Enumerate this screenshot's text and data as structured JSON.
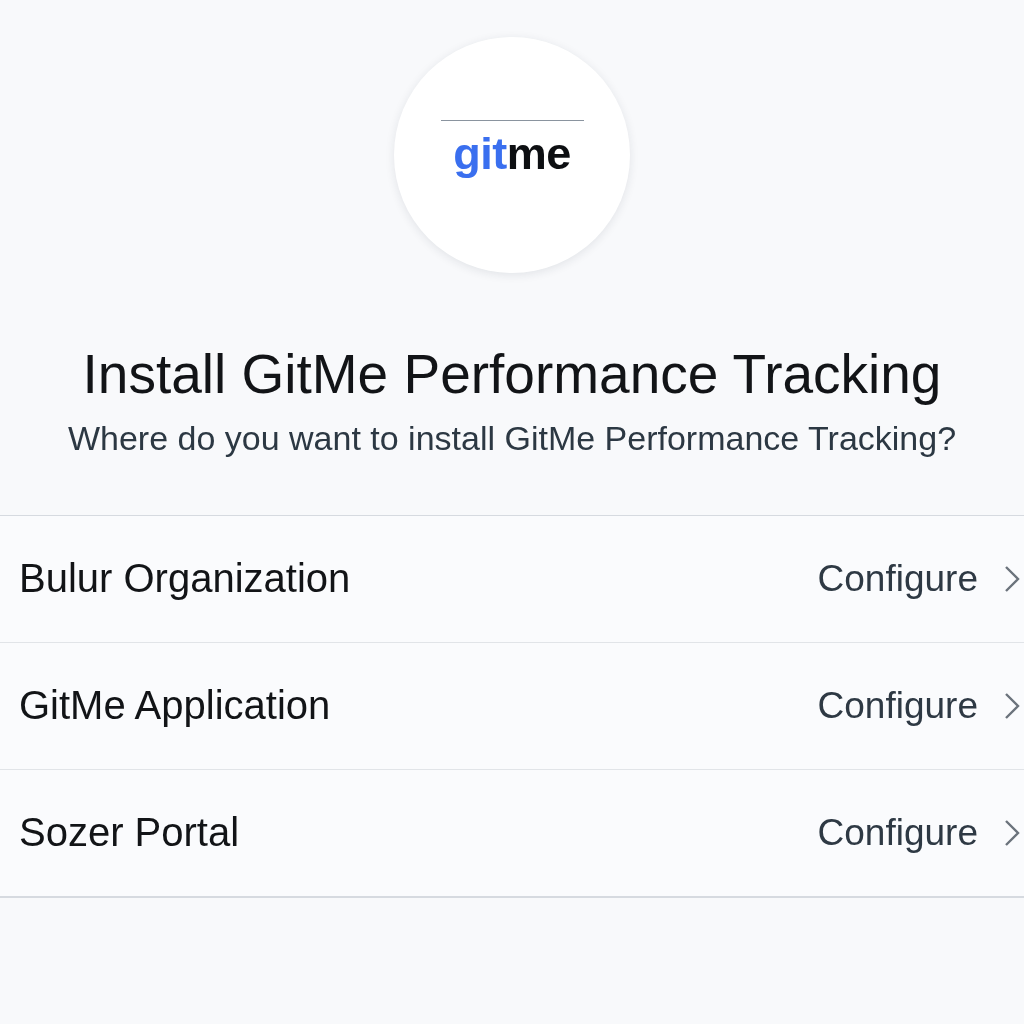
{
  "logo": {
    "accent": "git",
    "text": "me"
  },
  "title": "Install GitMe Performance Tracking",
  "subtitle": "Where do you want to install GitMe Performance Tracking?",
  "targets": [
    {
      "name": "Bulur Organization",
      "action": "Configure"
    },
    {
      "name": "GitMe Application",
      "action": "Configure"
    },
    {
      "name": "Sozer Portal",
      "action": "Configure"
    }
  ]
}
